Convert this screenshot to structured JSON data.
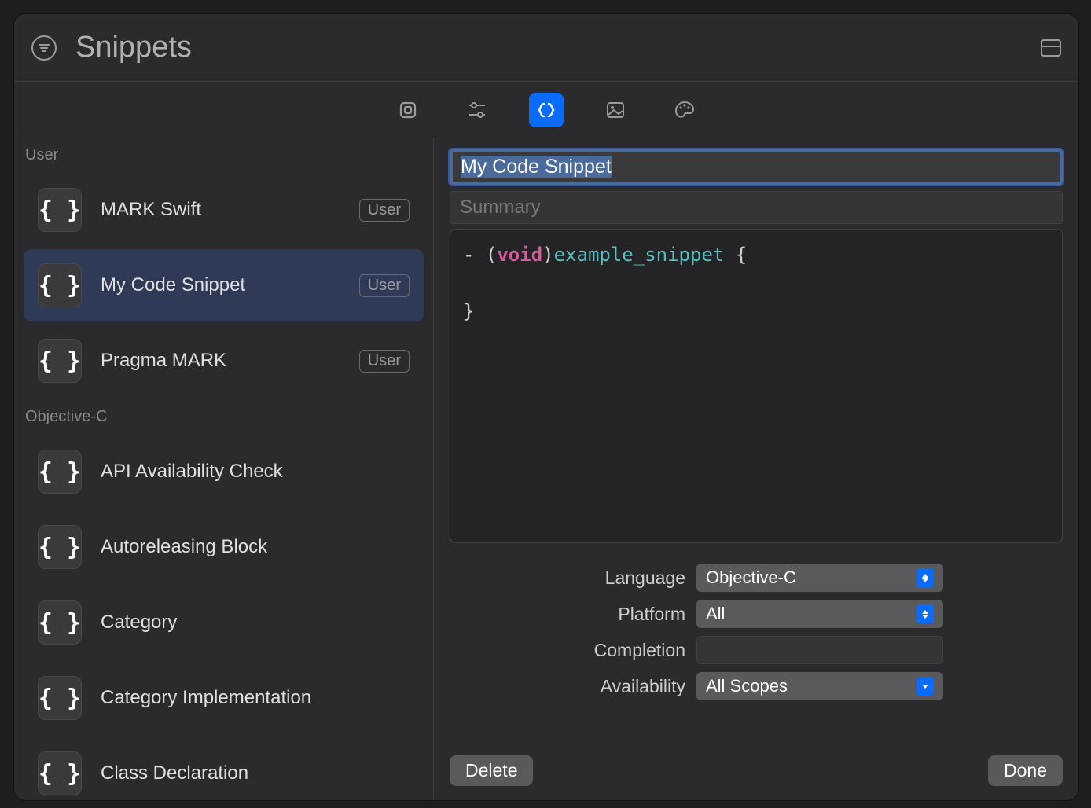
{
  "header": {
    "title": "Snippets"
  },
  "toolbar": {
    "items": [
      "views",
      "modifiers",
      "snippets",
      "media",
      "colors"
    ],
    "active": 2
  },
  "sidebar": {
    "groups": [
      {
        "label": "User",
        "items": [
          {
            "name": "MARK Swift",
            "badge": "User",
            "selected": false
          },
          {
            "name": "My Code Snippet",
            "badge": "User",
            "selected": true
          },
          {
            "name": "Pragma MARK",
            "badge": "User",
            "selected": false
          }
        ]
      },
      {
        "label": "Objective-C",
        "items": [
          {
            "name": "API Availability Check",
            "badge": null,
            "selected": false
          },
          {
            "name": "Autoreleasing Block",
            "badge": null,
            "selected": false
          },
          {
            "name": "Category",
            "badge": null,
            "selected": false
          },
          {
            "name": "Category Implementation",
            "badge": null,
            "selected": false
          },
          {
            "name": "Class Declaration",
            "badge": null,
            "selected": false
          }
        ]
      }
    ]
  },
  "detail": {
    "title_value": "My Code Snippet",
    "summary_placeholder": "Summary",
    "summary_value": "",
    "code": {
      "prefix": "- (",
      "kw": "void",
      "paren": ")",
      "fn": "example_snippet",
      "brace_open": " {",
      "line2": "",
      "brace_close": "}"
    },
    "form": {
      "language_label": "Language",
      "language_value": "Objective-C",
      "platform_label": "Platform",
      "platform_value": "All",
      "completion_label": "Completion",
      "completion_value": "",
      "availability_label": "Availability",
      "availability_value": "All Scopes"
    },
    "buttons": {
      "delete": "Delete",
      "done": "Done"
    }
  }
}
